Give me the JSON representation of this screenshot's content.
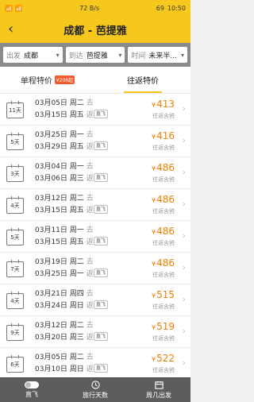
{
  "status": {
    "left": "📶 📶",
    "net": "72 B/s",
    "battery": "69",
    "time": "10:50"
  },
  "header": {
    "back_icon": "chevron-left-icon",
    "title": "成都 - 芭提雅"
  },
  "filters": [
    {
      "key": "出发",
      "value": "成都"
    },
    {
      "key": "到达",
      "value": "芭提雅"
    },
    {
      "key": "时间",
      "value": "未来半..."
    }
  ],
  "tabs": [
    {
      "label": "单程特价",
      "badge": "¥206起"
    },
    {
      "label": "往返特价"
    }
  ],
  "rows": [
    {
      "days": "11天",
      "go": "03月05日 周二",
      "back": "03月15日 周五",
      "go_tag": "去",
      "back_tag": "返",
      "direct": "直飞",
      "price": "413",
      "tax": "往返含税"
    },
    {
      "days": "5天",
      "go": "03月25日 周一",
      "back": "03月29日 周五",
      "go_tag": "去",
      "back_tag": "返",
      "direct": "直飞",
      "price": "416",
      "tax": "往返含税"
    },
    {
      "days": "3天",
      "go": "03月04日 周一",
      "back": "03月06日 周三",
      "go_tag": "去",
      "back_tag": "返",
      "direct": "直飞",
      "price": "486",
      "tax": "往返含税"
    },
    {
      "days": "4天",
      "go": "03月12日 周二",
      "back": "03月15日 周五",
      "go_tag": "去",
      "back_tag": "返",
      "direct": "直飞",
      "price": "486",
      "tax": "往返含税"
    },
    {
      "days": "5天",
      "go": "03月11日 周一",
      "back": "03月15日 周五",
      "go_tag": "去",
      "back_tag": "返",
      "direct": "直飞",
      "price": "486",
      "tax": "往返含税"
    },
    {
      "days": "7天",
      "go": "03月19日 周二",
      "back": "03月25日 周一",
      "go_tag": "去",
      "back_tag": "返",
      "direct": "直飞",
      "price": "486",
      "tax": "往返含税"
    },
    {
      "days": "4天",
      "go": "03月21日 周四",
      "back": "03月24日 周日",
      "go_tag": "去",
      "back_tag": "返",
      "direct": "直飞",
      "price": "515",
      "tax": "往返含税"
    },
    {
      "days": "9天",
      "go": "03月12日 周二",
      "back": "03月20日 周三",
      "go_tag": "去",
      "back_tag": "返",
      "direct": "直飞",
      "price": "519",
      "tax": "往返含税"
    },
    {
      "days": "6天",
      "go": "03月05日 周二",
      "back": "03月10日 周日",
      "go_tag": "去",
      "back_tag": "返",
      "direct": "直飞",
      "price": "522",
      "tax": "往返含税"
    }
  ],
  "currency": "¥",
  "bottom": [
    {
      "label": "直飞",
      "icon": "toggle-icon"
    },
    {
      "label": "旅行天数",
      "icon": "clock-icon"
    },
    {
      "label": "周几出发",
      "icon": "calendar-icon"
    }
  ],
  "colors": {
    "accent": "#f6c81d",
    "price": "#f57c00"
  }
}
